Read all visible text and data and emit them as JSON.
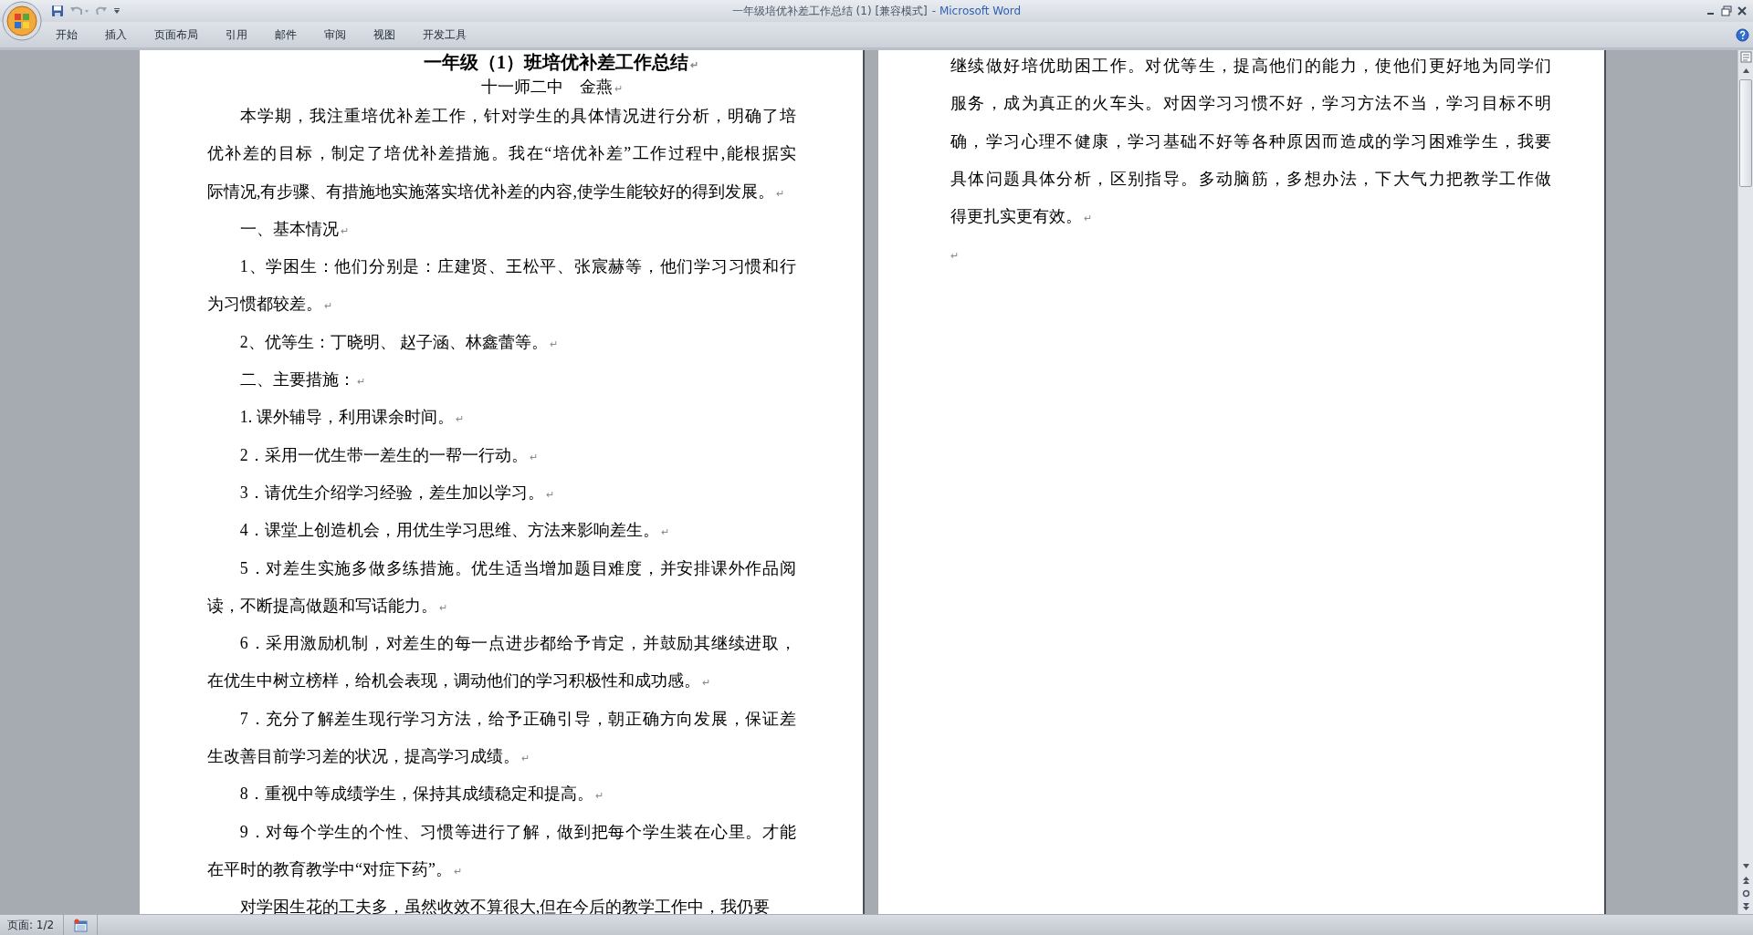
{
  "window": {
    "title": "一年级培优补差工作总结 (1) [兼容模式]",
    "app_name": "- Microsoft Word"
  },
  "ribbon_tabs": [
    {
      "label": "开始"
    },
    {
      "label": "插入"
    },
    {
      "label": "页面布局"
    },
    {
      "label": "引用"
    },
    {
      "label": "邮件"
    },
    {
      "label": "审阅"
    },
    {
      "label": "视图"
    },
    {
      "label": "开发工具"
    }
  ],
  "pages": [
    {
      "paragraphs": [
        {
          "kind": "title",
          "lines": [
            "一年级（1）班培优补差工作总结"
          ],
          "mark": "↵"
        },
        {
          "kind": "subtitle",
          "lines": [
            "十一师二中　金燕"
          ],
          "mark": "↵"
        },
        {
          "kind": "body",
          "lines": [
            "本学期，我注重培优补差工作，针对学生的具体情况进行分析，明确了培",
            "优补差的目标，制定了培优补差措施。我在“培优补差”工作过程中,能根据实",
            "际情况,有步骤、有措施地实施落实培优补差的内容,使学生能较好的得到发展。"
          ],
          "mark": "↵"
        },
        {
          "kind": "body",
          "lines": [
            "一、基本情况"
          ],
          "mark": "↵"
        },
        {
          "kind": "body",
          "lines": [
            "1、学困生：他们分别是：庄建贤、王松平、张宸赫等，他们学习习惯和行",
            "为习惯都较差。"
          ],
          "mark": "↵"
        },
        {
          "kind": "body",
          "lines": [
            "2、优等生：丁晓明、 赵子涵、林鑫蕾等。"
          ],
          "mark": "↵"
        },
        {
          "kind": "body",
          "lines": [
            "二、主要措施："
          ],
          "mark": "↵"
        },
        {
          "kind": "body",
          "lines": [
            "1. 课外辅导，利用课余时间。"
          ],
          "mark": "↵"
        },
        {
          "kind": "body",
          "lines": [
            "2．采用一优生带一差生的一帮一行动。"
          ],
          "mark": "↵"
        },
        {
          "kind": "body",
          "lines": [
            "3．请优生介绍学习经验，差生加以学习。"
          ],
          "mark": "↵"
        },
        {
          "kind": "body",
          "lines": [
            "4．课堂上创造机会，用优生学习思维、方法来影响差生。"
          ],
          "mark": "↵"
        },
        {
          "kind": "body",
          "lines": [
            "5．对差生实施多做多练措施。优生适当增加题目难度，并安排课外作品阅",
            "读，不断提高做题和写话能力。"
          ],
          "mark": "↵"
        },
        {
          "kind": "body",
          "lines": [
            "6．采用激励机制，对差生的每一点进步都给予肯定，并鼓励其继续进取，",
            "在优生中树立榜样，给机会表现，调动他们的学习积极性和成功感。"
          ],
          "mark": "↵"
        },
        {
          "kind": "body",
          "lines": [
            "7．充分了解差生现行学习方法，给予正确引导，朝正确方向发展，保证差",
            "生改善目前学习差的状况，提高学习成绩。"
          ],
          "mark": "↵"
        },
        {
          "kind": "body",
          "lines": [
            "8．重视中等成绩学生，保持其成绩稳定和提高。"
          ],
          "mark": "↵"
        },
        {
          "kind": "body",
          "lines": [
            "9．对每个学生的个性、习惯等进行了解，做到把每个学生装在心里。才能",
            "在平时的教育教学中“对症下药”。"
          ],
          "mark": "↵"
        },
        {
          "kind": "body",
          "lines": [
            "对学困生花的工夫多，虽然收效不算很大,但在今后的教学工作中，我仍要"
          ]
        }
      ]
    },
    {
      "paragraphs": [
        {
          "kind": "continued",
          "lines": [
            "继续做好培优助困工作。对优等生，提高他们的能力，使他们更好地为同学们",
            "服务，成为真正的火车头。对因学习习惯不好，学习方法不当，学习目标不明",
            "确，学习心理不健康，学习基础不好等各种原因而造成的学习困难学生，我要",
            "具体问题具体分析，区别指导。多动脑筋，多想办法，下大气力把教学工作做",
            "得更扎实更有效。"
          ],
          "mark": "↵"
        },
        {
          "kind": "empty",
          "mark": "↵"
        }
      ]
    }
  ],
  "status_bar": {
    "page": "页面: 1/2"
  }
}
